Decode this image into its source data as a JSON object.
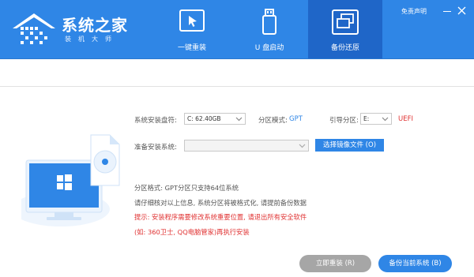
{
  "app": {
    "title": "系统之家",
    "subtitle": "装机大师",
    "disclaimer": "免责声明"
  },
  "nav": {
    "tabs": [
      {
        "label": "一键重装",
        "icon": "cursor-screen-icon"
      },
      {
        "label": "U 盘启动",
        "icon": "usb-drive-icon"
      },
      {
        "label": "备份还原",
        "icon": "backup-windows-icon"
      }
    ],
    "active_index": 2
  },
  "form": {
    "disk_label": "系统安装盘符:",
    "disk_value": "C: 62.40GB",
    "partition_mode_label": "分区模式:",
    "partition_mode_value": "GPT",
    "boot_partition_label": "引导分区:",
    "boot_partition_value": "E:",
    "boot_mode_value": "UEFI",
    "prepare_label": "准备安装系统:",
    "prepare_value": "",
    "choose_image_button": "选择镜像文件 (O)"
  },
  "info": {
    "line1": "分区格式: GPT分区只支持64位系统",
    "line2": "请仔细核对以上信息, 系统分区将被格式化, 请提前备份数据",
    "line3": "提示: 安装程序需要修改系统重要位置, 请退出所有安全软件",
    "line4": "(如: 360卫士, QQ电脑管家)再执行安装"
  },
  "actions": {
    "reinstall_button": "立即重装 (R)",
    "backup_button": "备份当前系统 (B)"
  },
  "colors": {
    "header": "#2f86e6",
    "active_tab": "#1f66c8",
    "accent": "#2f86e6",
    "warning": "#e03232",
    "button_gray": "#a6a6a6"
  }
}
